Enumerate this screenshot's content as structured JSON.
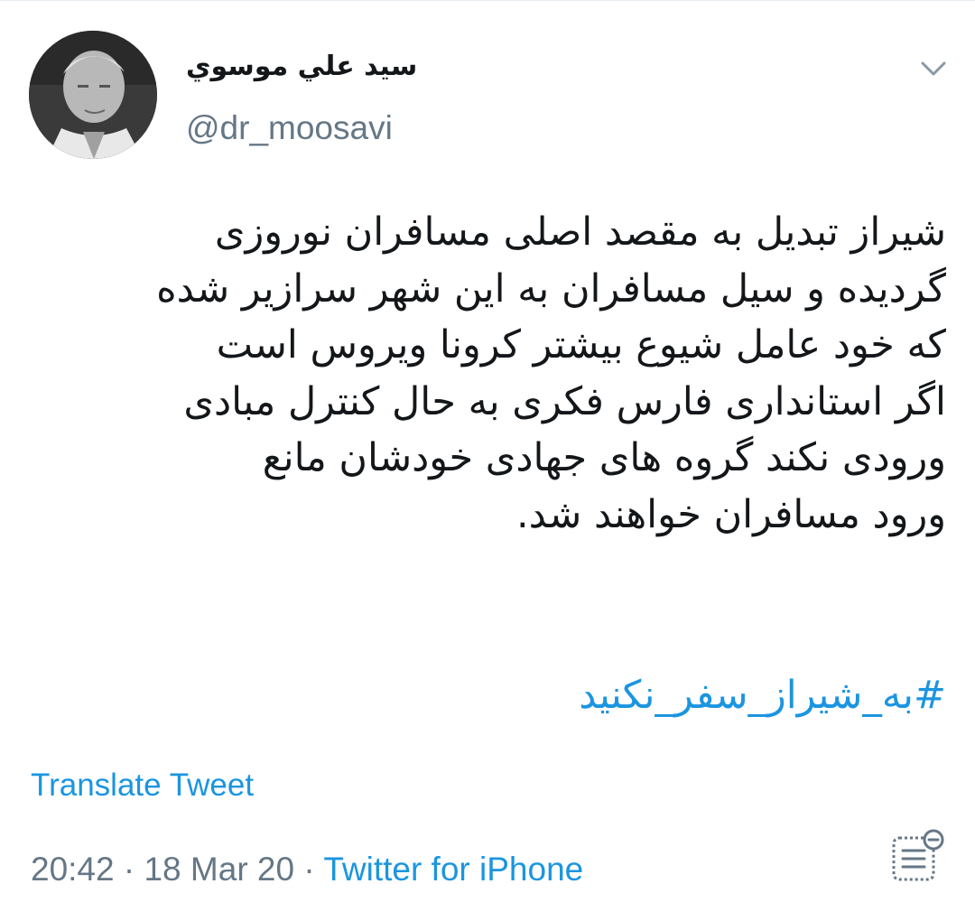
{
  "tweet": {
    "display_name": "سيد علي موسوي",
    "handle": "@dr_moosavi",
    "text": "شیراز تبدیل به مقصد اصلی مسافران نوروزی\nگردیده و سیل مسافران به این شهر سرازیر شده\nکه خود عامل شیوع بیشتر کرونا ویروس است\nاگر استانداری فارس فکری به حال کنترل مبادی\nورودی نکند گروه های جهادی خودشان مانع\nورود مسافران خواهند شد.",
    "hashtag": "#به_شیراز_سفر_نکنید",
    "translate_label": "Translate Tweet",
    "time": "20:42",
    "date": "18 Mar 20",
    "separator": "·",
    "source": "Twitter for iPhone"
  },
  "icons": {
    "menu": "chevron-down-icon",
    "analytics": "analytics-icon"
  },
  "colors": {
    "link": "#1b95e0",
    "secondary": "#657786",
    "text": "#14171a"
  }
}
